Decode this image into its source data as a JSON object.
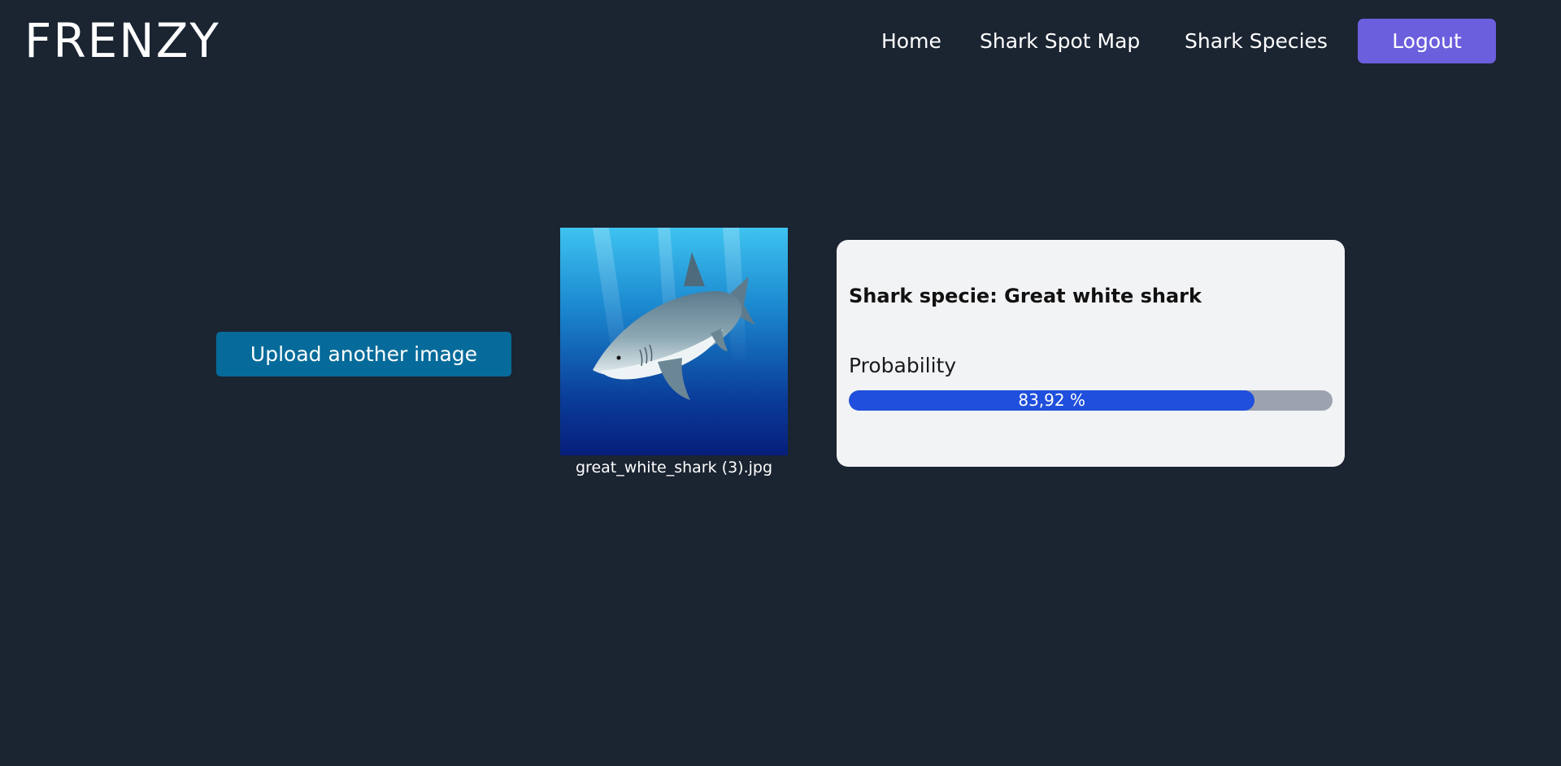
{
  "header": {
    "brand": "FRENZY",
    "nav": [
      {
        "label": "Home"
      },
      {
        "label": "Shark Spot Map"
      },
      {
        "label": "Shark Species"
      }
    ],
    "logout_label": "Logout"
  },
  "upload": {
    "button_label": "Upload another image"
  },
  "image": {
    "filename": "great_white_shark (3).jpg"
  },
  "result": {
    "species_text": "Shark specie: Great white shark",
    "probability_label": "Probability",
    "probability_text": "83,92 %",
    "probability_value": 0.8392
  },
  "colors": {
    "background": "#1b2431",
    "logout_button": "#6c5fdd",
    "upload_button": "#066b9a",
    "card": "#f2f3f5",
    "bar_fill": "#1f4fdc",
    "bar_track": "#9ca3af"
  }
}
